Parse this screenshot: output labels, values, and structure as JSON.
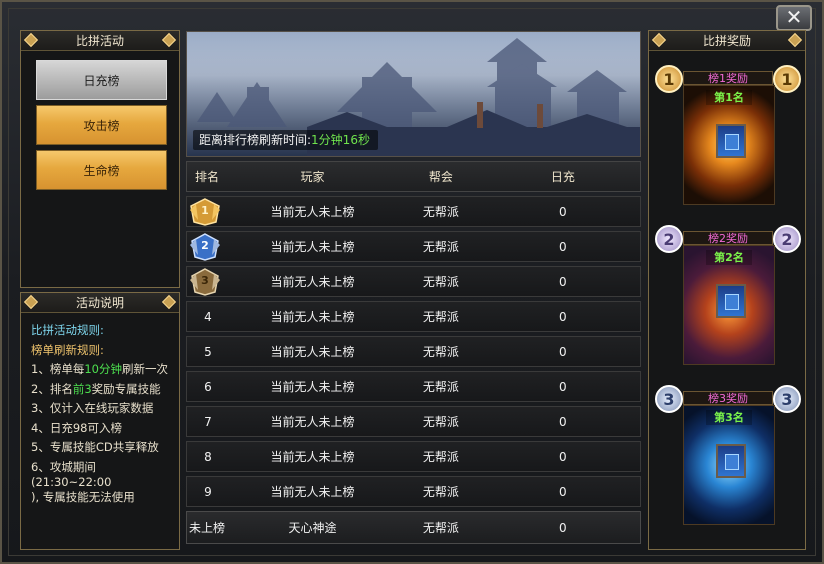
{
  "window": {
    "close_glyph": "✕"
  },
  "left": {
    "rank_title": "比拼活动",
    "tabs": [
      {
        "label": "日充榜",
        "active": true
      },
      {
        "label": "攻击榜",
        "active": false
      },
      {
        "label": "生命榜",
        "active": false
      }
    ],
    "rules_title": "活动说明",
    "rules": {
      "line1": "比拼活动规则:",
      "line2": "榜单刷新规则:",
      "item1_pre": "1、榜单每",
      "item1_hl": "10分钟",
      "item1_post": "刷新一次",
      "item2_pre": "2、排名",
      "item2_hl": "前3",
      "item2_post": "奖励专属技能",
      "item3": "3、仅计入在线玩家数据",
      "item4": "4、日充98可入榜",
      "item5": "5、专属技能CD共享释放",
      "item6a": "6、攻城期间 (21:30~22:00",
      "item6b": "), 专属技能无法使用"
    }
  },
  "center": {
    "refresh_label": "距离排行榜刷新时间:",
    "refresh_time": "1分钟16秒",
    "headers": {
      "rank": "排名",
      "player": "玩家",
      "guild": "帮会",
      "daily": "日充"
    },
    "rows": [
      {
        "rank": "1",
        "player": "当前无人未上榜",
        "guild": "无帮派",
        "value": "0"
      },
      {
        "rank": "2",
        "player": "当前无人未上榜",
        "guild": "无帮派",
        "value": "0"
      },
      {
        "rank": "3",
        "player": "当前无人未上榜",
        "guild": "无帮派",
        "value": "0"
      },
      {
        "rank": "4",
        "player": "当前无人未上榜",
        "guild": "无帮派",
        "value": "0"
      },
      {
        "rank": "5",
        "player": "当前无人未上榜",
        "guild": "无帮派",
        "value": "0"
      },
      {
        "rank": "6",
        "player": "当前无人未上榜",
        "guild": "无帮派",
        "value": "0"
      },
      {
        "rank": "7",
        "player": "当前无人未上榜",
        "guild": "无帮派",
        "value": "0"
      },
      {
        "rank": "8",
        "player": "当前无人未上榜",
        "guild": "无帮派",
        "value": "0"
      },
      {
        "rank": "9",
        "player": "当前无人未上榜",
        "guild": "无帮派",
        "value": "0"
      }
    ],
    "my_row": {
      "rank": "未上榜",
      "player": "天心神途",
      "guild": "无帮派",
      "value": "0"
    }
  },
  "right": {
    "title": "比拼奖励",
    "rewards": [
      {
        "label": "榜1奖励",
        "badge": "1",
        "place": "第1名"
      },
      {
        "label": "榜2奖励",
        "badge": "2",
        "place": "第2名"
      },
      {
        "label": "榜3奖励",
        "badge": "3",
        "place": "第3名"
      }
    ]
  },
  "colors": {
    "gold": "#f2c463",
    "cyan": "#7fd7ee",
    "green": "#6fe34d",
    "magenta": "#f36ad6"
  }
}
